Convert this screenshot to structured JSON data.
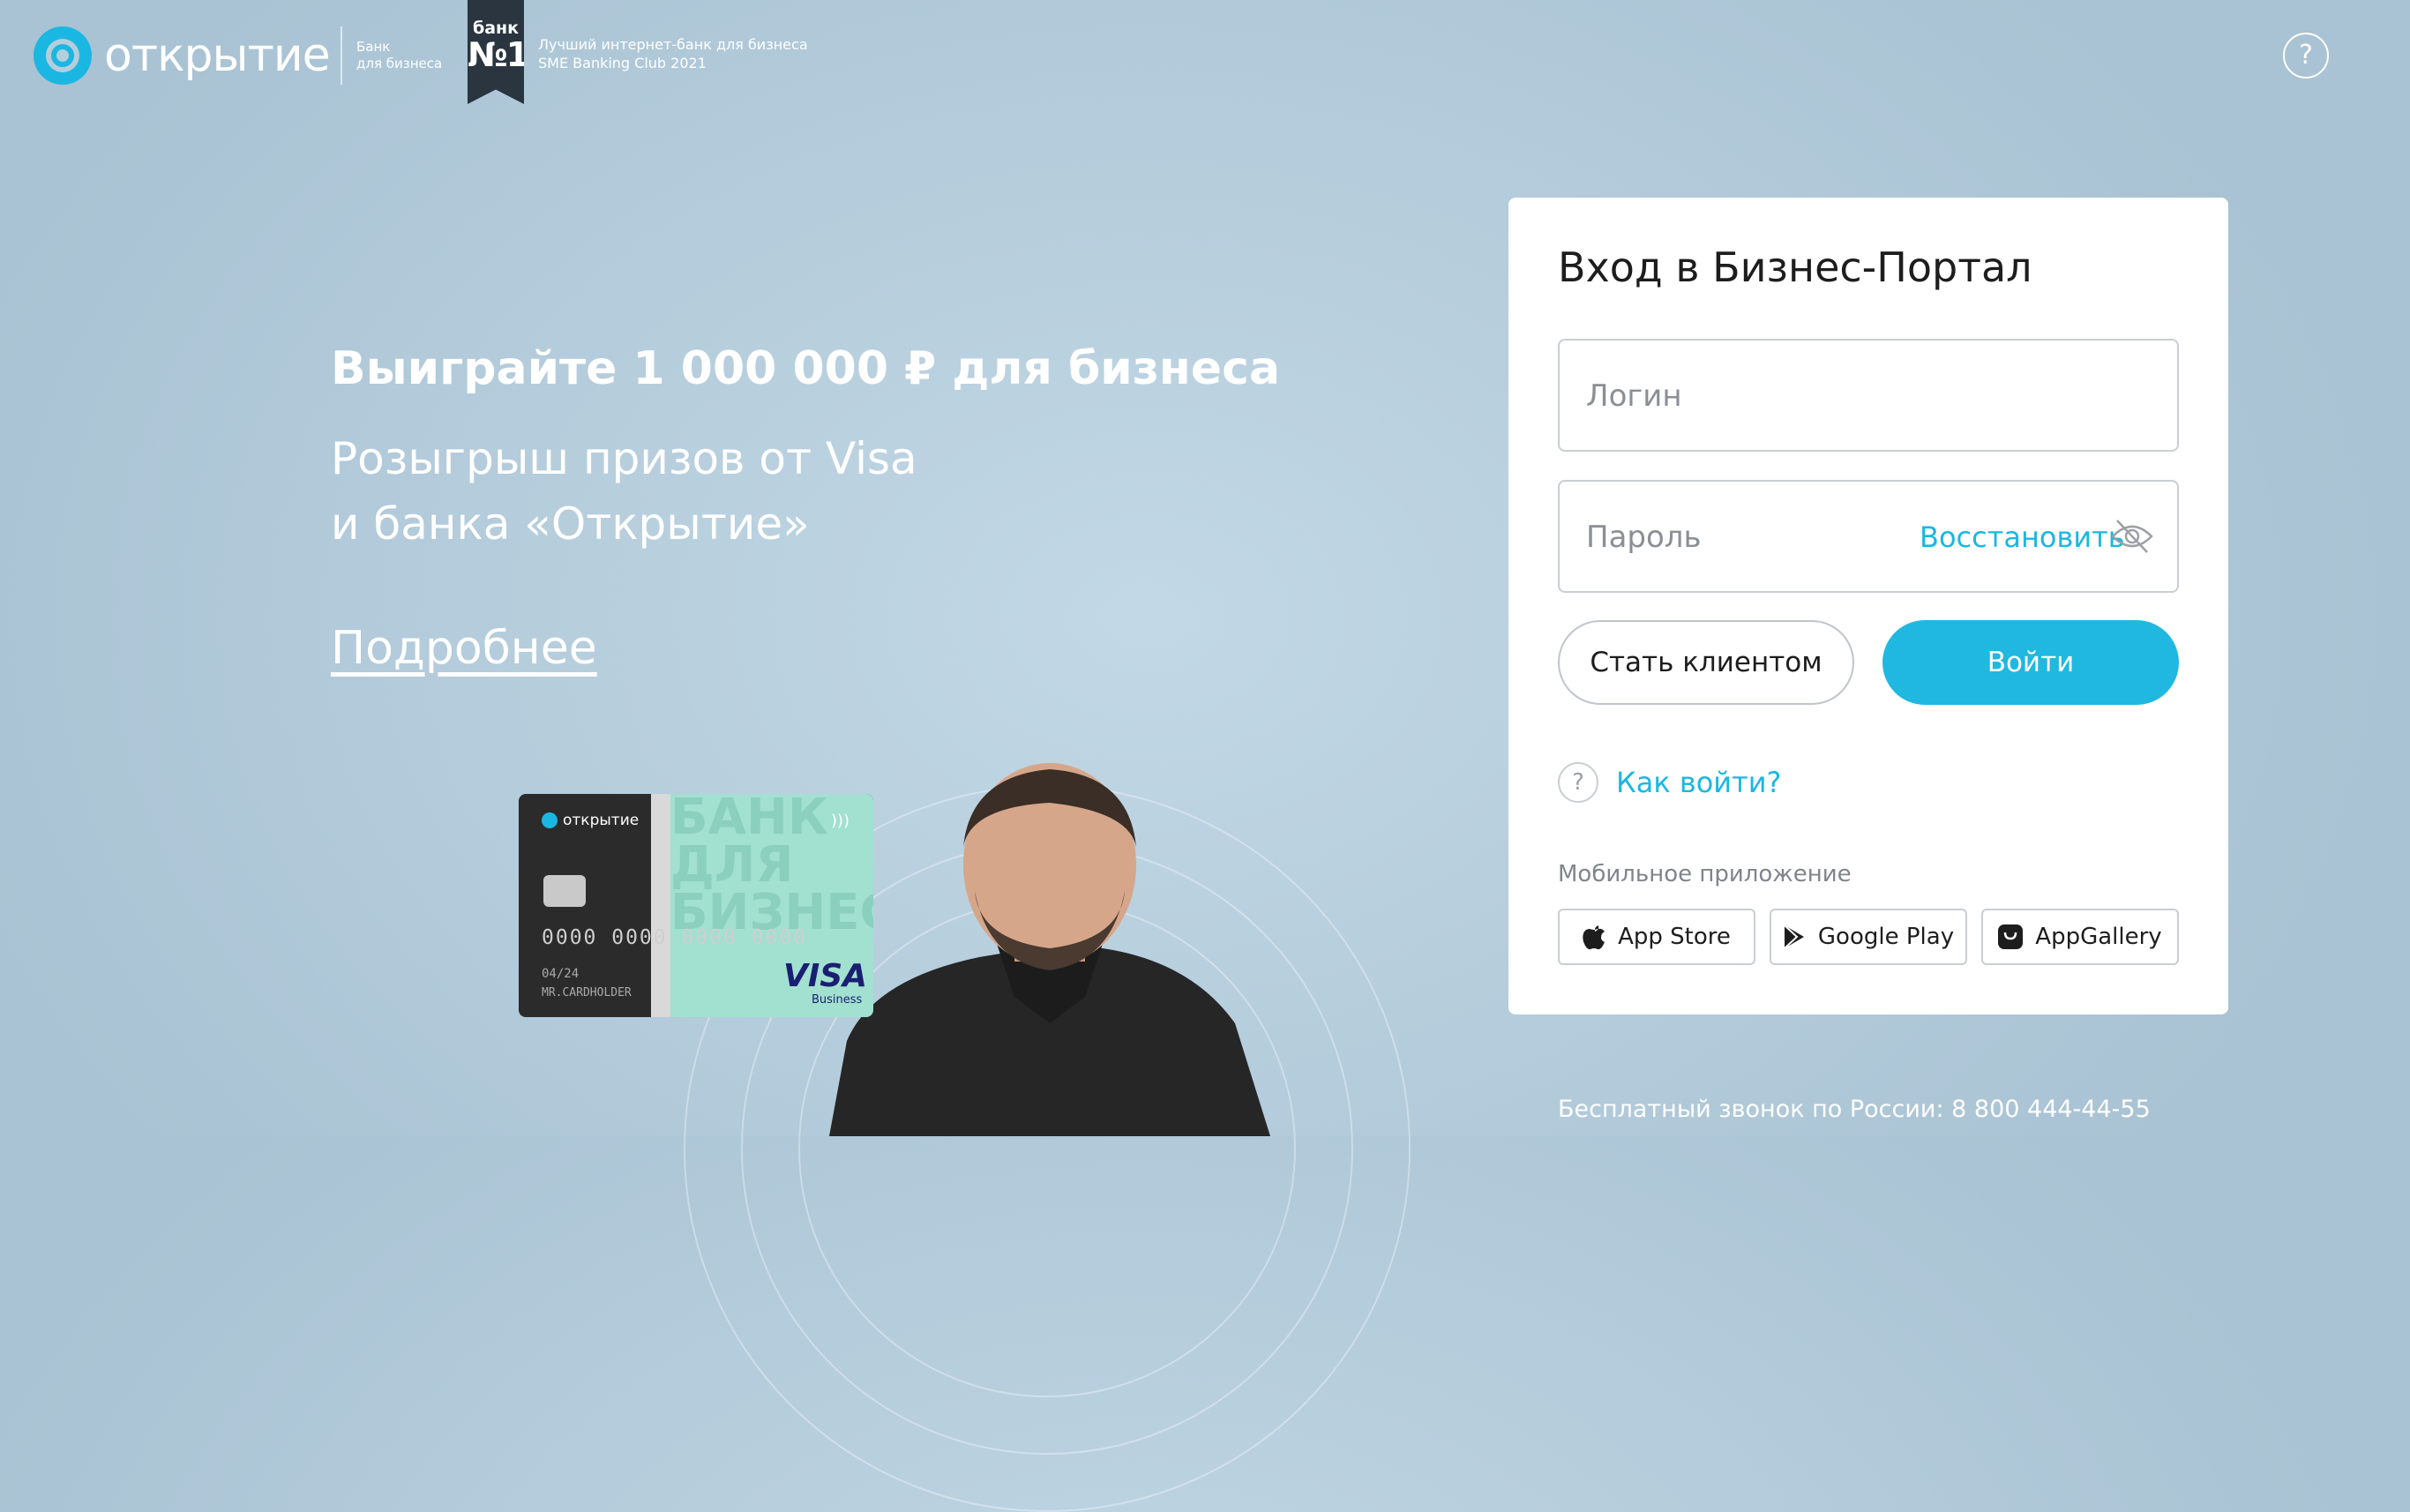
{
  "header": {
    "brand": "открытие",
    "brand_sub_1": "Банк",
    "brand_sub_2": "для бизнеса",
    "ribbon_top": "банк",
    "ribbon_bottom": "№1",
    "award_1": "Лучший интернет-банк для бизнеса",
    "award_2": "SME Banking Club 2021",
    "help": "?"
  },
  "promo": {
    "title": "Выиграйте 1 000 000 ₽ для бизнеса",
    "subtitle_1": "Розыгрыш призов от Visa",
    "subtitle_2": "и банка «Открытие»",
    "link": "Подробнее"
  },
  "card": {
    "brand": "открытие",
    "number": "0000 0000 0000 0000",
    "expiry": "04/24",
    "holder": "MR.CARDHOLDER",
    "big_text_1": "БАНК",
    "big_text_2": "ДЛЯ",
    "big_text_3": "БИЗНЕСА",
    "network": "VISA",
    "network_sub": "Business"
  },
  "login": {
    "title": "Вход в Бизнес-Портал",
    "login_placeholder": "Логин",
    "password_placeholder": "Пароль",
    "restore": "Восстановить",
    "become_client": "Стать клиентом",
    "sign_in": "Войти",
    "how_to": "Как войти?",
    "mobile_app": "Мобильное приложение",
    "stores": [
      "App Store",
      "Google Play",
      "AppGallery"
    ]
  },
  "footer": {
    "phone": "Бесплатный звонок по России: 8 800 444-44-55"
  },
  "colors": {
    "accent": "#1ab7e2",
    "background": "#b7cedd",
    "ribbon": "#2a3540"
  }
}
